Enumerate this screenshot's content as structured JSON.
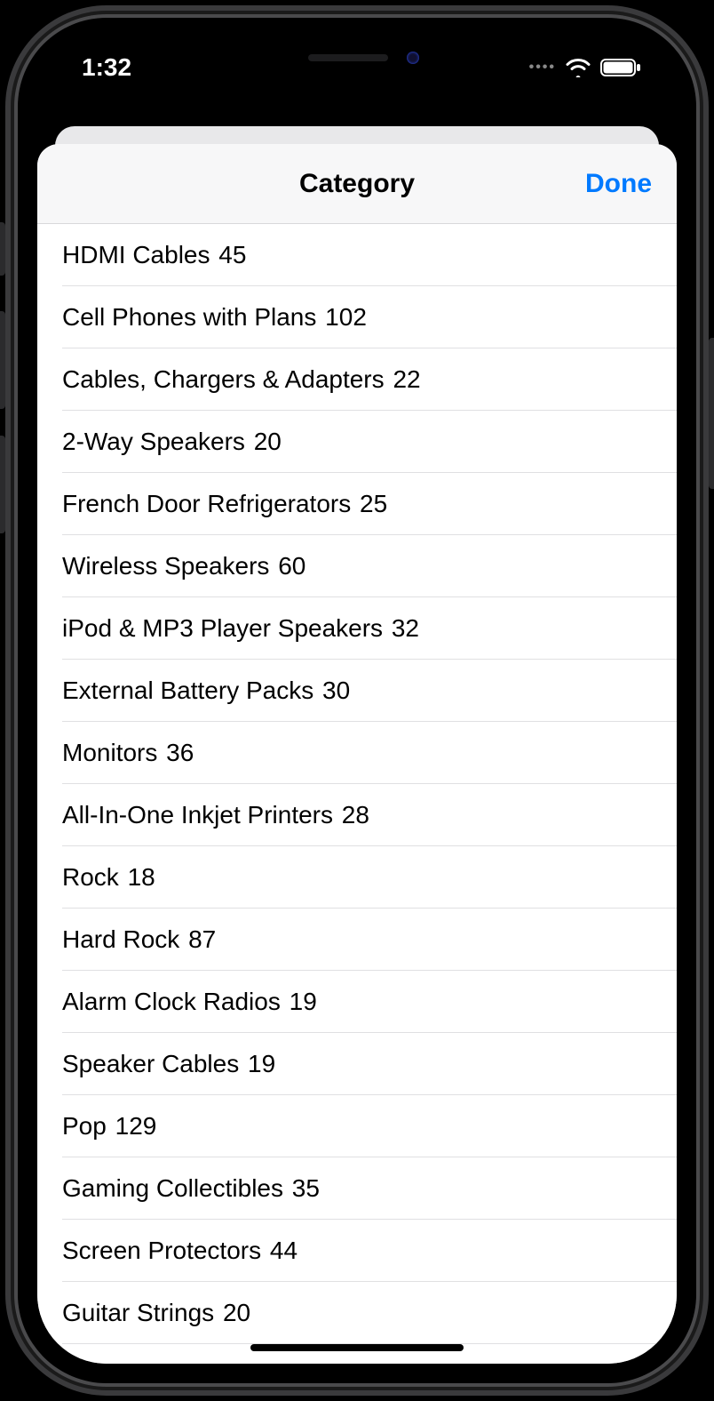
{
  "status": {
    "time": "1:32"
  },
  "sheet": {
    "title": "Category",
    "done_label": "Done",
    "items": [
      {
        "name": "HDMI Cables",
        "count": 45
      },
      {
        "name": "Cell Phones with Plans",
        "count": 102
      },
      {
        "name": "Cables, Chargers & Adapters",
        "count": 22
      },
      {
        "name": "2-Way Speakers",
        "count": 20
      },
      {
        "name": "French Door Refrigerators",
        "count": 25
      },
      {
        "name": "Wireless Speakers",
        "count": 60
      },
      {
        "name": "iPod & MP3 Player Speakers",
        "count": 32
      },
      {
        "name": "External Battery Packs",
        "count": 30
      },
      {
        "name": "Monitors",
        "count": 36
      },
      {
        "name": "All-In-One Inkjet Printers",
        "count": 28
      },
      {
        "name": "Rock",
        "count": 18
      },
      {
        "name": "Hard Rock",
        "count": 87
      },
      {
        "name": "Alarm Clock Radios",
        "count": 19
      },
      {
        "name": "Speaker Cables",
        "count": 19
      },
      {
        "name": "Pop",
        "count": 129
      },
      {
        "name": "Gaming Collectibles",
        "count": 35
      },
      {
        "name": "Screen Protectors",
        "count": 44
      },
      {
        "name": "Guitar Strings",
        "count": 20
      }
    ]
  }
}
